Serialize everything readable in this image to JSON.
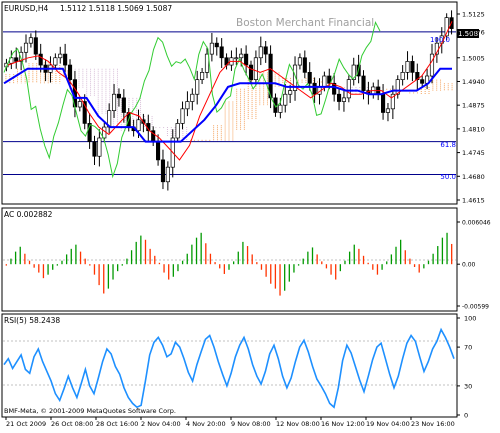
{
  "colors": {
    "background": "#ffffff",
    "frame": "#000000",
    "candle_up": "#ffffff",
    "candle_down": "#000000",
    "kijun": "#0000ff",
    "tenkan": "#ff0000",
    "chikou": "#33cc33",
    "kumo_a": "#f4a460",
    "kumo_b": "#d8bfd8",
    "hline": "#00008b",
    "ac_up": "#009900",
    "ac_down": "#ff3300",
    "rsi": "#1e90ff",
    "watermark": "#a0a0a0",
    "fibo_text": "#0000ff",
    "price_label_bg": "#000000",
    "price_label_fg": "#ffffff",
    "grid": "#c0c0c0"
  },
  "header": {
    "symbol": "EURUSD,H4",
    "ohlc": "1.5112 1.5118 1.5069 1.5087"
  },
  "watermark": "Boston Merchant Financial",
  "fibo": {
    "level_100": "100.0",
    "level_618": "61.8",
    "level_500": "50.0"
  },
  "price_tag": "1.5087",
  "ac_header": "AC 0.002882",
  "rsi_header": "RSI(5) 58.2438",
  "footer": "BMF-Meta, © 2001-2009 MetaQuotes Software Corp.",
  "chart_data": [
    {
      "type": "candlestick",
      "title": "EURUSD,H4",
      "ylim": [
        1.4615,
        1.5125
      ],
      "y_ticks": [
        "1.5125",
        "1.5076",
        "1.5005",
        "1.4940",
        "1.4875",
        "1.4810",
        "1.4745",
        "1.4680",
        "1.4615"
      ],
      "x_ticks": [
        "21 Oct 2009",
        "26 Oct 08:00",
        "28 Oct 16:00",
        "2 Nov 04:00",
        "4 Nov 20:00",
        "9 Nov 08:00",
        "12 Nov 08:00",
        "16 Nov 12:00",
        "19 Nov 04:00",
        "23 Nov 16:00"
      ],
      "horizontal_lines": [
        {
          "label": "100.0",
          "y": 1.5076
        },
        {
          "label": "61.8",
          "y": 1.4775
        },
        {
          "label": "50.0",
          "y": 1.4685
        }
      ],
      "close_series": [
        1.499,
        1.5005,
        1.4995,
        1.502,
        1.5045,
        1.506,
        1.5015,
        1.4985,
        1.4965,
        1.4985,
        1.5005,
        1.5015,
        1.4985,
        1.4945,
        1.487,
        1.4885,
        1.4825,
        1.4775,
        1.4735,
        1.4785,
        1.4815,
        1.486,
        1.4905,
        1.4895,
        1.4855,
        1.4815,
        1.4805,
        1.4835,
        1.4825,
        1.4805,
        1.4775,
        1.4725,
        1.4665,
        1.4705,
        1.4785,
        1.4825,
        1.4865,
        1.4885,
        1.4905,
        1.4945,
        1.4965,
        1.5015,
        1.5045,
        1.5035,
        1.5005,
        1.4985,
        1.5005,
        1.5005,
        1.5015,
        1.4985,
        1.4945,
        1.5005,
        1.5035,
        1.5015,
        1.4895,
        1.4855,
        1.4875,
        1.4905,
        1.4915,
        1.4985,
        1.5005,
        1.4965,
        1.4935,
        1.4905,
        1.4925,
        1.4955,
        1.4935,
        1.4905,
        1.4885,
        1.4895,
        1.4945,
        1.4985,
        1.4955,
        1.4915,
        1.4905,
        1.4925,
        1.4905,
        1.4855,
        1.4865,
        1.4905,
        1.4945,
        1.4965,
        1.4995,
        1.4965,
        1.4945,
        1.4935,
        1.4955,
        1.5015,
        1.5045,
        1.5065,
        1.5115,
        1.5085
      ],
      "tenkan_series": [
        1.4985,
        1.4995,
        1.5005,
        1.501,
        1.4995,
        1.4965,
        1.4945,
        1.4905,
        1.4855,
        1.4815,
        1.4795,
        1.4825,
        1.4855,
        1.4845,
        1.4805,
        1.4785,
        1.4755,
        1.4725,
        1.4765,
        1.4845,
        1.4905,
        1.4965,
        1.4995,
        1.4995,
        1.4975,
        1.4965,
        1.4975,
        1.4955,
        1.4935,
        1.4915,
        1.4895,
        1.4915,
        1.4935,
        1.4925,
        1.4905,
        1.4905,
        1.4915,
        1.4915,
        1.4895,
        1.4915,
        1.4935,
        1.4955,
        1.4995,
        1.5045,
        1.5105
      ],
      "kijun_series": [
        1.4935,
        1.4955,
        1.4975,
        1.4975,
        1.4975,
        1.4975,
        1.4895,
        1.4895,
        1.4845,
        1.4815,
        1.4815,
        1.4815,
        1.4775,
        1.4775,
        1.4775,
        1.4775,
        1.4805,
        1.4835,
        1.4875,
        1.4925,
        1.4935,
        1.4935,
        1.4935,
        1.4935,
        1.4925,
        1.4925,
        1.4925,
        1.4925,
        1.4925,
        1.4915,
        1.4915,
        1.4905,
        1.4905,
        1.4915,
        1.4915,
        1.4915,
        1.4935,
        1.4975,
        1.4975
      ]
    },
    {
      "type": "bar",
      "title": "AC 0.002882",
      "ylim": [
        -0.00599,
        0.006046
      ],
      "y_ticks": [
        "0.006046",
        "0.00",
        "-0.00599"
      ],
      "values": [
        -0.0002,
        0.0008,
        0.0018,
        0.0025,
        0.0015,
        0.0005,
        -0.0005,
        -0.0012,
        -0.002,
        -0.0015,
        -0.0008,
        -0.0002,
        0.0005,
        0.0014,
        0.0022,
        0.0028,
        0.0018,
        0.0008,
        -0.0002,
        -0.0015,
        -0.003,
        -0.0042,
        -0.0035,
        -0.0022,
        -0.001,
        -0.0002,
        0.0008,
        0.002,
        0.0032,
        0.0041,
        0.0035,
        0.0022,
        0.0012,
        0.0002,
        -0.0012,
        -0.0022,
        -0.0018,
        -0.001,
        0.0005,
        0.0015,
        0.0028,
        0.0038,
        0.0045,
        0.003,
        0.0015,
        0.0003,
        -0.0006,
        -0.0014,
        -0.0008,
        0.0004,
        0.0018,
        0.0032,
        0.0026,
        0.0014,
        0.0003,
        -0.0008,
        -0.0018,
        -0.0028,
        -0.0035,
        -0.0045,
        -0.0038,
        -0.0025,
        -0.0012,
        -0.0002,
        0.0008,
        0.0018,
        0.0024,
        0.0014,
        0.0004,
        -0.0006,
        -0.0015,
        -0.0022,
        -0.001,
        0.0005,
        0.0018,
        0.0028,
        0.0022,
        0.0012,
        0.0002,
        -0.0008,
        -0.0015,
        -0.0008,
        0.0004,
        0.0014,
        0.0025,
        0.0035,
        0.002,
        0.0008,
        -0.0004,
        -0.0012,
        -0.0006,
        0.0005,
        0.0015,
        0.0026,
        0.0038,
        0.0045,
        0.0029
      ]
    },
    {
      "type": "line",
      "title": "RSI(5) 58.2438",
      "ylim": [
        0,
        100
      ],
      "y_ticks": [
        "100",
        "70",
        "30",
        "0"
      ],
      "values": [
        52,
        58,
        48,
        55,
        62,
        47,
        43,
        60,
        68,
        55,
        45,
        35,
        22,
        15,
        27,
        40,
        28,
        18,
        32,
        47,
        30,
        22,
        38,
        55,
        68,
        63,
        50,
        42,
        28,
        18,
        12,
        8,
        10,
        35,
        62,
        75,
        80,
        72,
        60,
        63,
        75,
        70,
        58,
        44,
        35,
        52,
        65,
        78,
        82,
        70,
        55,
        42,
        30,
        43,
        60,
        72,
        80,
        68,
        52,
        40,
        32,
        45,
        63,
        72,
        58,
        40,
        28,
        38,
        55,
        70,
        77,
        65,
        50,
        37,
        30,
        22,
        12,
        8,
        28,
        56,
        72,
        64,
        50,
        36,
        24,
        40,
        57,
        70,
        74,
        58,
        42,
        28,
        40,
        58,
        74,
        82,
        76,
        60,
        45,
        55,
        68,
        76,
        88,
        80,
        70,
        58
      ]
    }
  ]
}
